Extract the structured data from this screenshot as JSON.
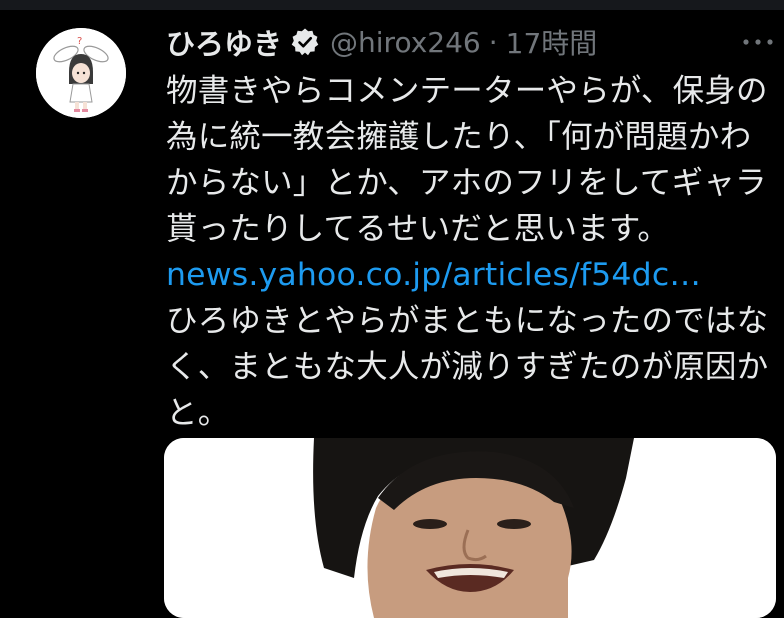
{
  "tweet": {
    "author": {
      "display_name": "ひろゆき",
      "handle": "@hirox246",
      "verified": true
    },
    "separator": "·",
    "timestamp": "17時間",
    "more_icon": "more-icon",
    "body_lines": [
      "物書きやらコメンテーターやらが、保身の",
      "為に統一教会擁護したり、「何が問題かわ",
      "からない」とか、アホのフリをしてギャラ",
      "貰ったりしてるせいだと思います。"
    ],
    "link": "news.yahoo.co.jp/articles/f54dc…",
    "body_lines_2": [
      "ひろゆきとやらがまともになったのではな",
      "く、まともな大人が減りすぎたのが原因か",
      "と。"
    ]
  },
  "colors": {
    "background": "#000000",
    "text": "#e7e9ea",
    "secondary_text": "#71767b",
    "link": "#1d9bf0"
  }
}
